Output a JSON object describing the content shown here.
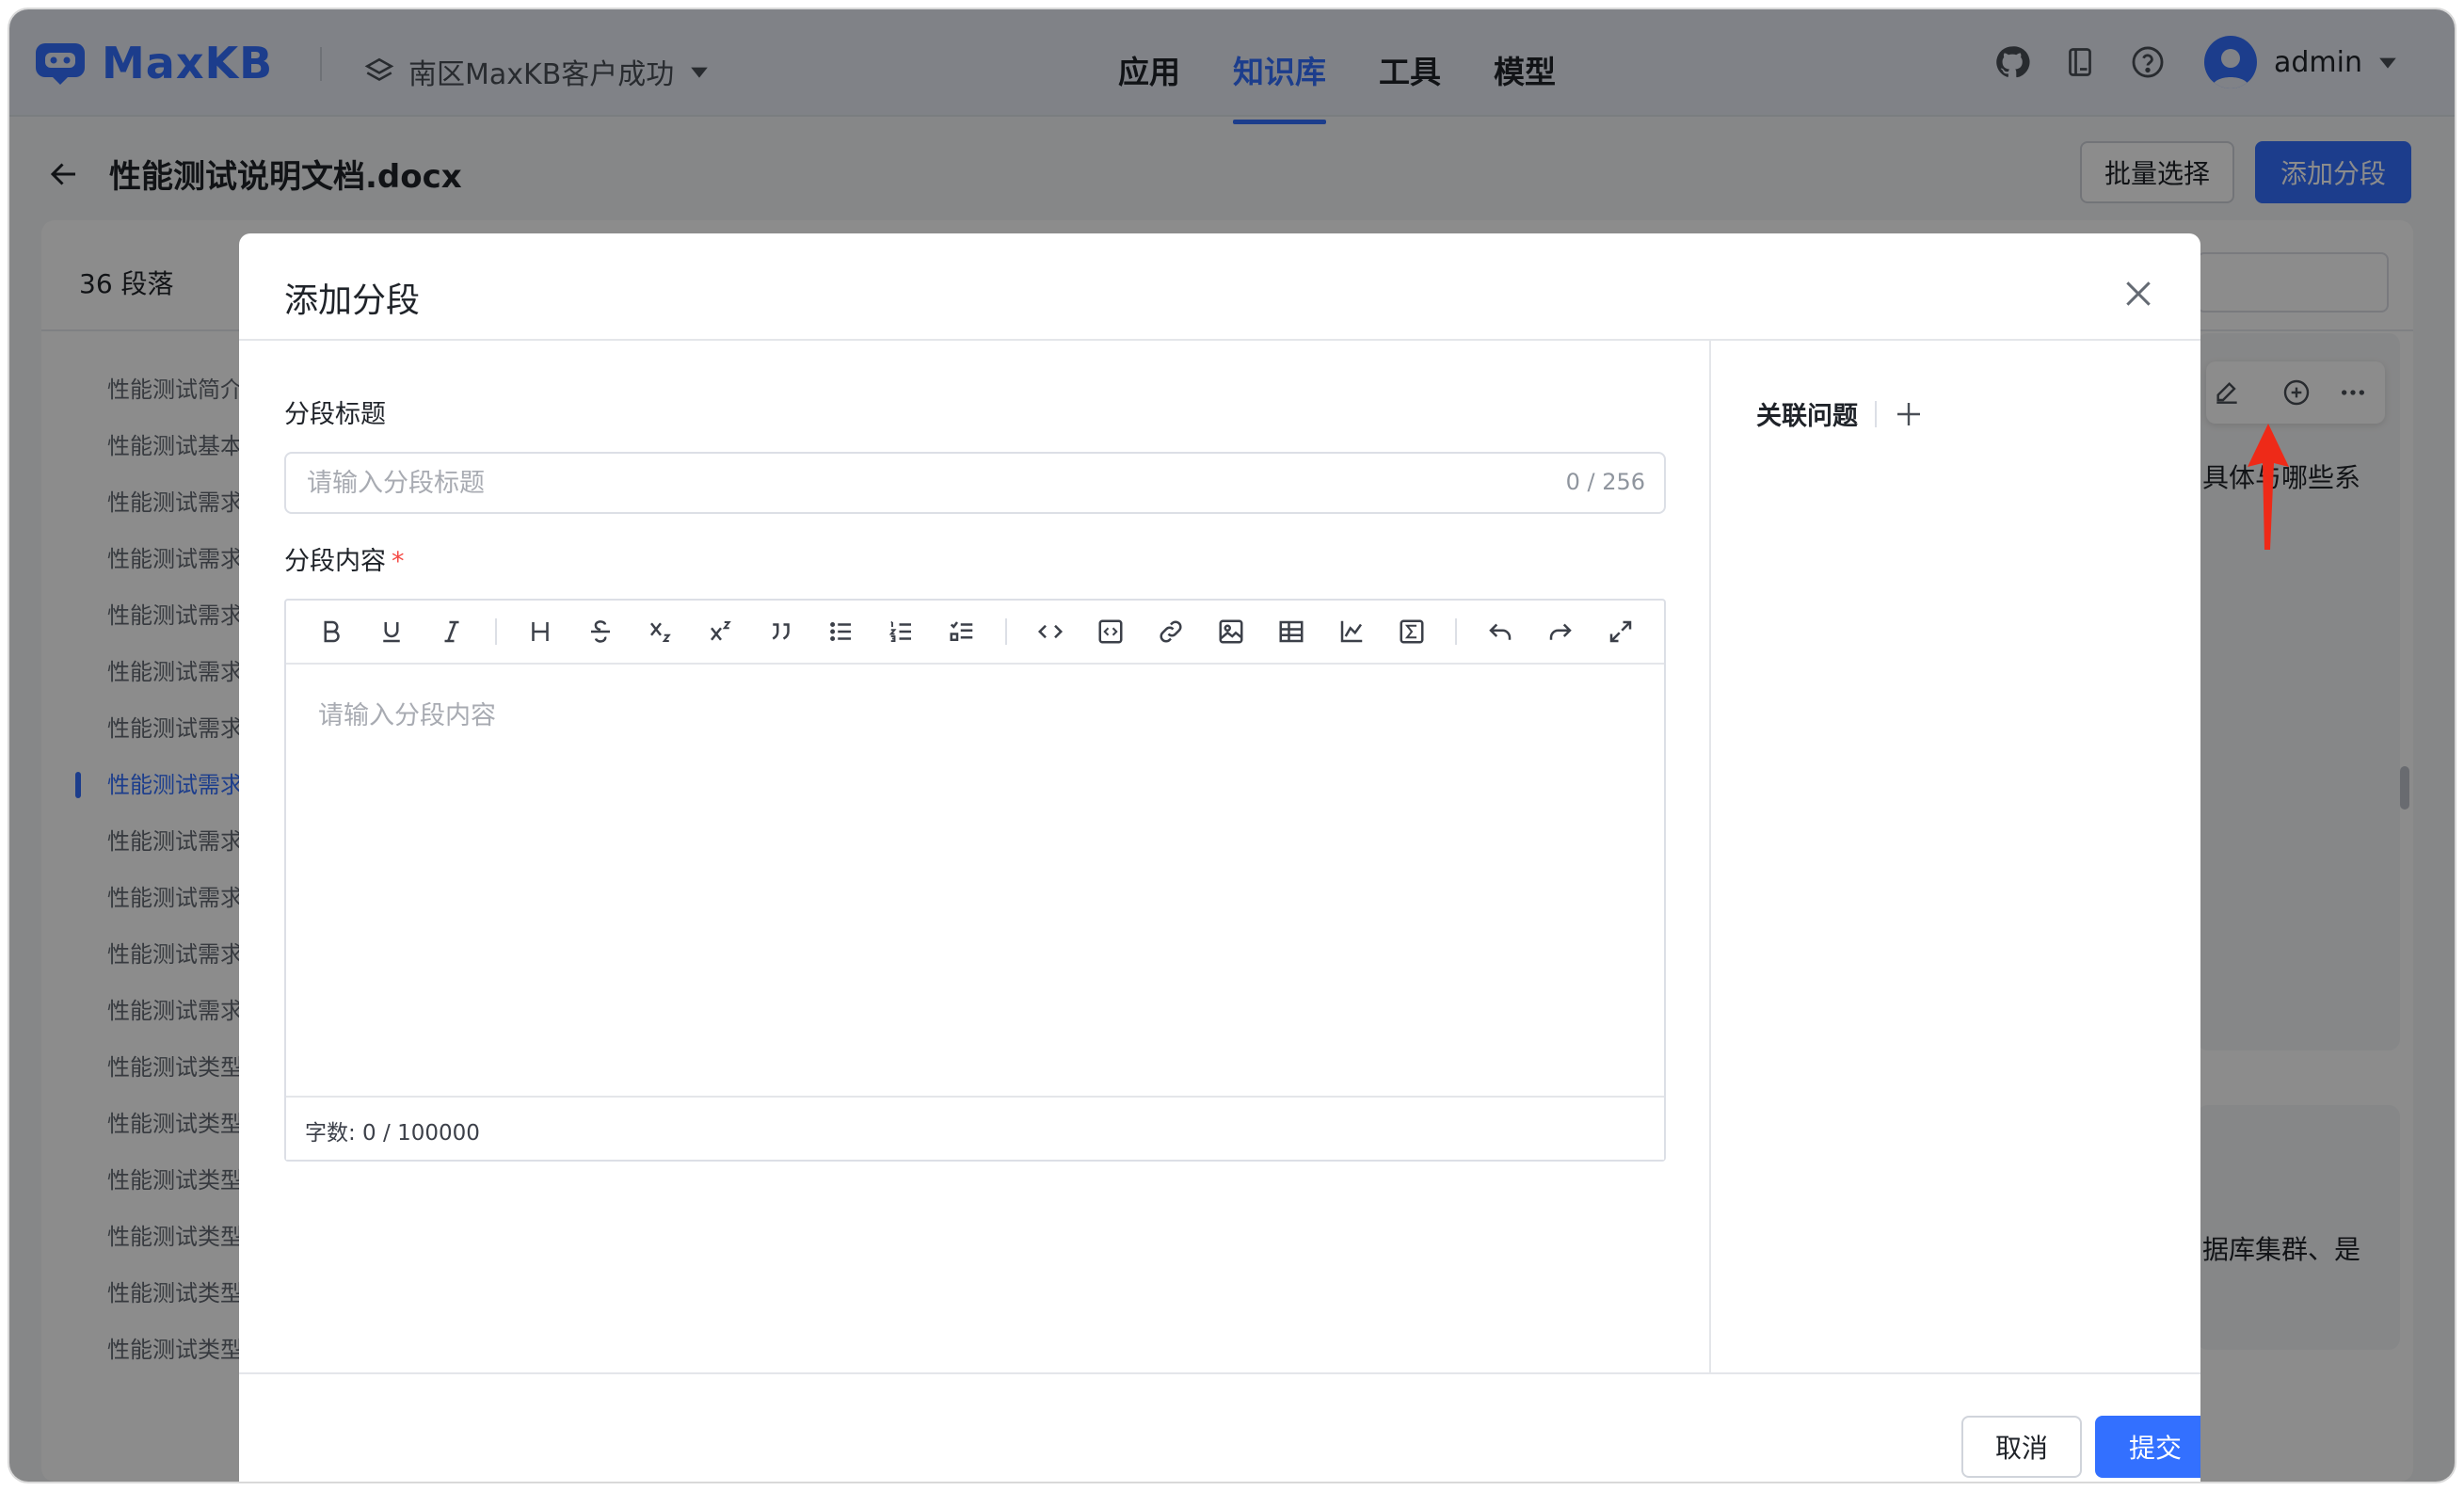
{
  "app": {
    "name": "MaxKB",
    "workspace": "南区MaxKB客户成功",
    "brand_color": "#3370ff"
  },
  "nav": {
    "tabs": [
      {
        "label": "应用",
        "active": false
      },
      {
        "label": "知识库",
        "active": true
      },
      {
        "label": "工具",
        "active": false
      },
      {
        "label": "模型",
        "active": false
      }
    ]
  },
  "user": {
    "name": "admin"
  },
  "page": {
    "title": "性能测试说明文档.docx",
    "batch_select_label": "批量选择",
    "add_segment_label": "添加分段",
    "paragraph_count": "36 段落"
  },
  "sidebar": {
    "items": [
      {
        "label": "性能测试简介",
        "active": false
      },
      {
        "label": "性能测试基本流程",
        "active": false
      },
      {
        "label": "性能测试需求分析",
        "active": false
      },
      {
        "label": "性能测试需求分析",
        "active": false
      },
      {
        "label": "性能测试需求分析",
        "active": false
      },
      {
        "label": "性能测试需求分析",
        "active": false
      },
      {
        "label": "性能测试需求分析",
        "active": false
      },
      {
        "label": "性能测试需求分析",
        "active": true
      },
      {
        "label": "性能测试需求分析",
        "active": false
      },
      {
        "label": "性能测试需求分析",
        "active": false
      },
      {
        "label": "性能测试需求分析",
        "active": false
      },
      {
        "label": "性能测试需求分析",
        "active": false
      },
      {
        "label": "性能测试类型",
        "active": false
      },
      {
        "label": "性能测试类型",
        "active": false
      },
      {
        "label": "性能测试类型",
        "active": false
      },
      {
        "label": "性能测试类型",
        "active": false
      },
      {
        "label": "性能测试类型",
        "active": false
      },
      {
        "label": "性能测试类型",
        "active": false
      }
    ]
  },
  "background_snippets": {
    "snippet1": "具体与哪些系",
    "snippet2": "据库集群、是"
  },
  "dialog": {
    "title": "添加分段",
    "segment_title_label": "分段标题",
    "segment_title_placeholder": "请输入分段标题",
    "segment_title_counter": "0 / 256",
    "segment_content_label": "分段内容",
    "required_mark": "*",
    "content_placeholder": "请输入分段内容",
    "word_count": "字数: 0 / 100000",
    "related_questions_label": "关联问题",
    "cancel_label": "取消",
    "submit_label": "提交"
  },
  "toolbar_icons": [
    "bold-icon",
    "underline-icon",
    "italic-icon",
    "heading-icon",
    "strikethrough-icon",
    "subscript-icon",
    "superscript-icon",
    "quote-icon",
    "bullet-list-icon",
    "ordered-list-icon",
    "task-list-icon",
    "inline-code-icon",
    "code-block-icon",
    "link-icon",
    "image-icon",
    "table-icon",
    "chart-icon",
    "formula-icon",
    "undo-icon",
    "redo-icon",
    "fullscreen-icon"
  ]
}
